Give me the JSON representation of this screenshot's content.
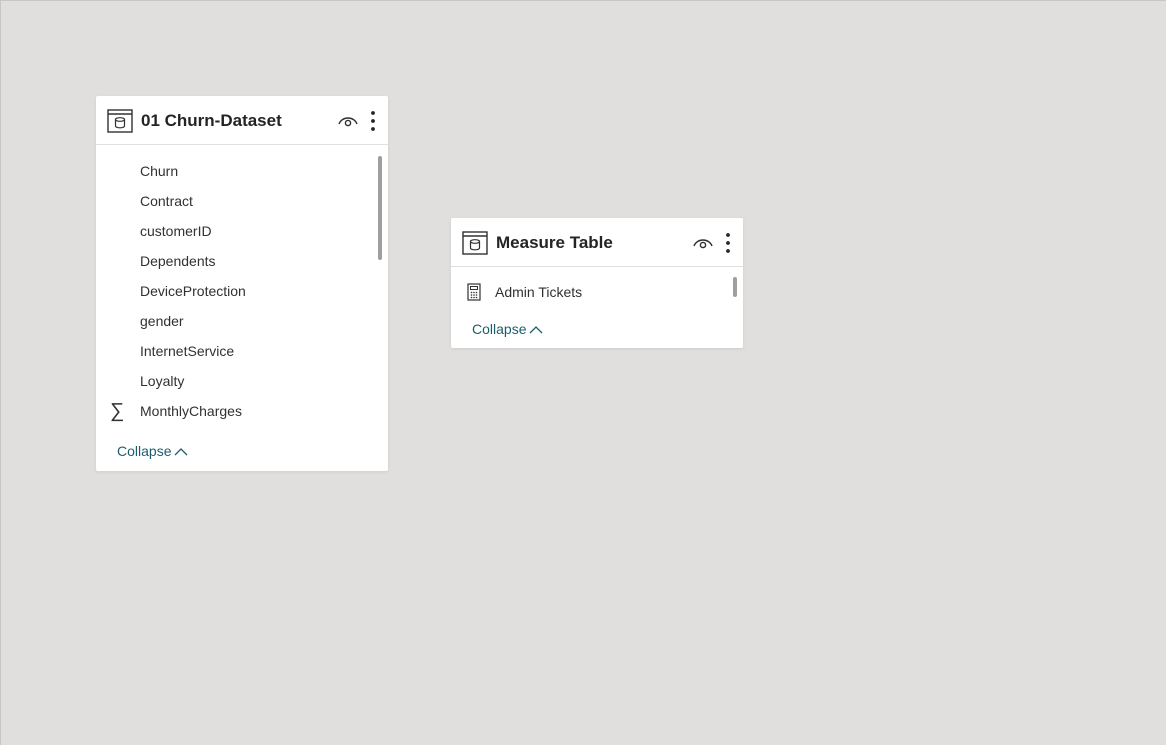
{
  "tables": [
    {
      "title": "01 Churn-Dataset",
      "fields": [
        {
          "label": "Churn",
          "icon": "none"
        },
        {
          "label": "Contract",
          "icon": "none"
        },
        {
          "label": "customerID",
          "icon": "none"
        },
        {
          "label": "Dependents",
          "icon": "none"
        },
        {
          "label": "DeviceProtection",
          "icon": "none"
        },
        {
          "label": "gender",
          "icon": "none"
        },
        {
          "label": "InternetService",
          "icon": "none"
        },
        {
          "label": "Loyalty",
          "icon": "none"
        },
        {
          "label": "MonthlyCharges",
          "icon": "sigma-icon",
          "glyph": "∑"
        }
      ],
      "collapse_label": "Collapse"
    },
    {
      "title": "Measure Table",
      "fields": [
        {
          "label": "Admin Tickets",
          "icon": "calculator-icon"
        }
      ],
      "collapse_label": "Collapse"
    }
  ],
  "colors": {
    "canvas": "#e1dfdd",
    "card": "#ffffff",
    "title_text": "#252423",
    "field_text": "#323130",
    "collapse_link": "#1b5e6b",
    "scrollbar": "#a19f9d"
  }
}
